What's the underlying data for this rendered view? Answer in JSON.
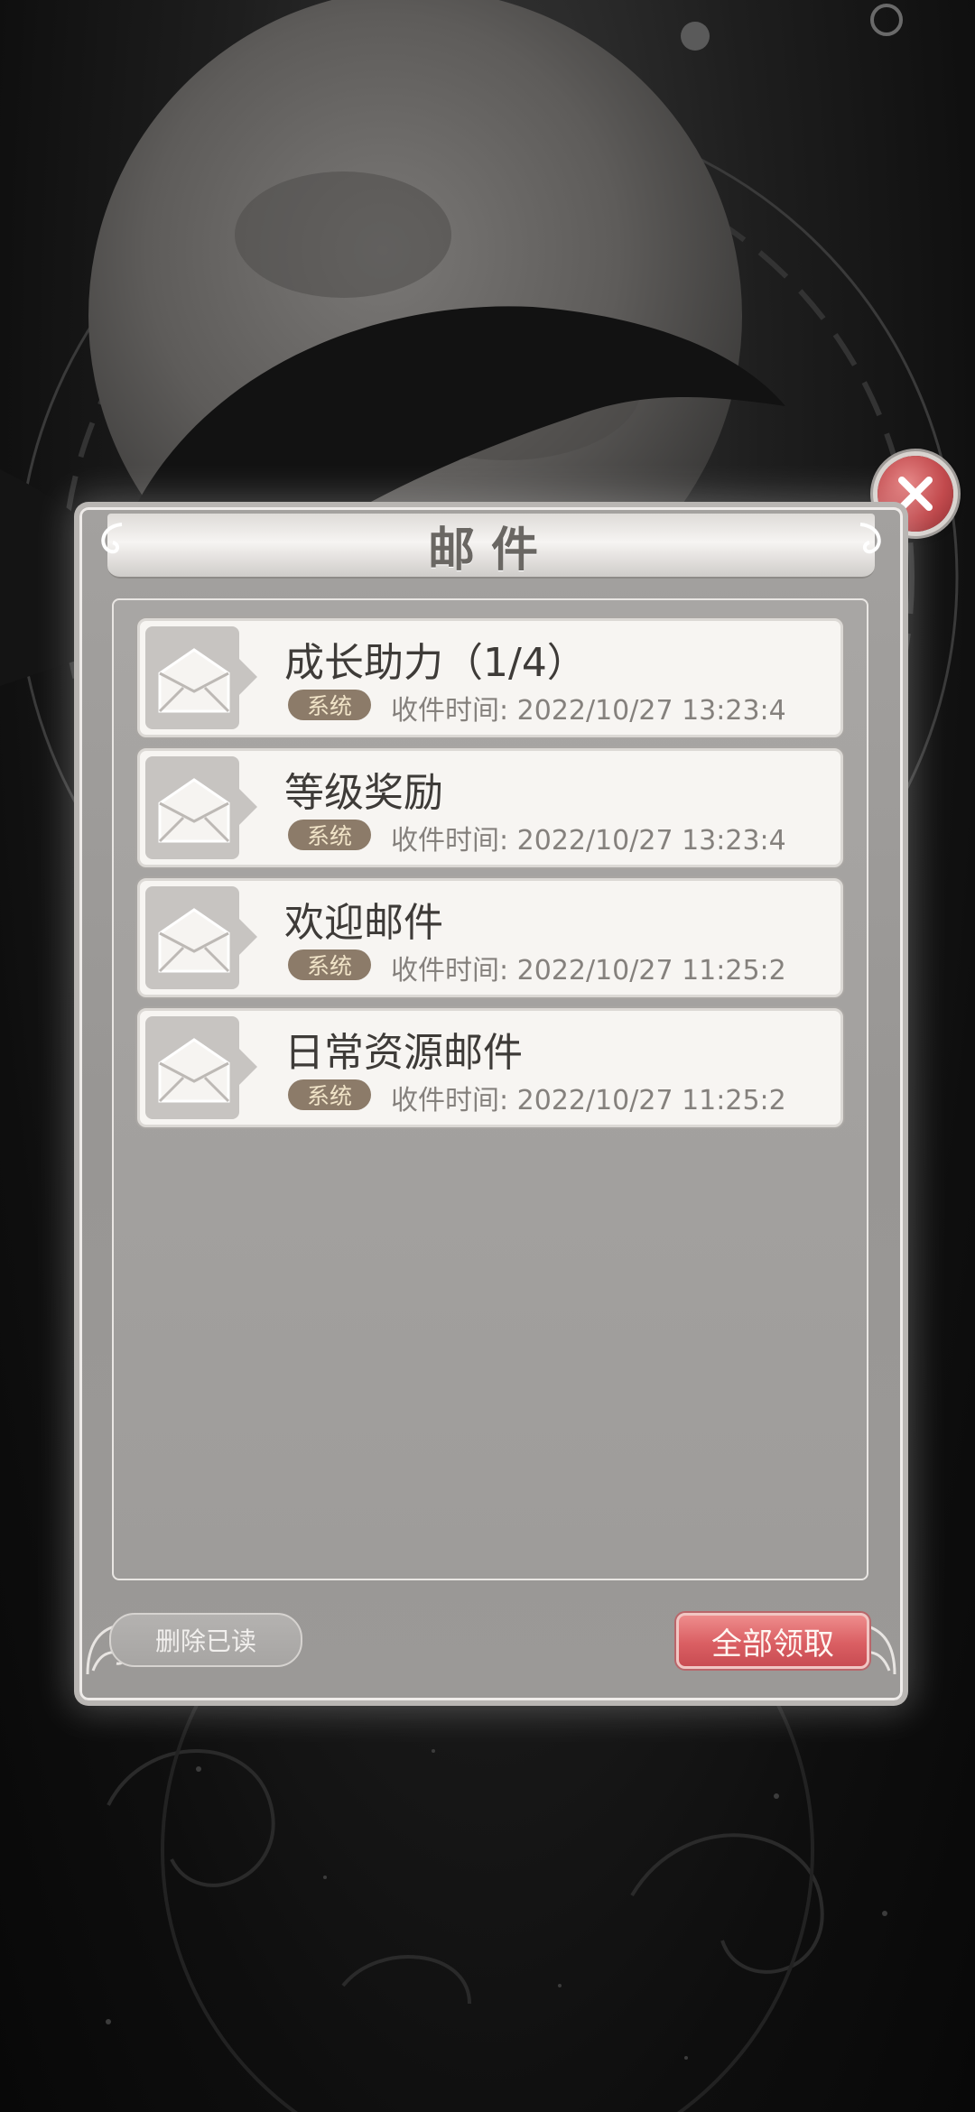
{
  "dialog": {
    "title": "邮件",
    "close_icon": "close-x-icon",
    "accent_color": "#d65a5e"
  },
  "mails": [
    {
      "title": "成长助力（1/4）",
      "tag": "系统",
      "time": "收件时间: 2022/10/27 13:23:4",
      "icon": "envelope-icon"
    },
    {
      "title": "等级奖励",
      "tag": "系统",
      "time": "收件时间: 2022/10/27 13:23:4",
      "icon": "envelope-icon"
    },
    {
      "title": "欢迎邮件",
      "tag": "系统",
      "time": "收件时间: 2022/10/27 11:25:2",
      "icon": "envelope-icon"
    },
    {
      "title": "日常资源邮件",
      "tag": "系统",
      "time": "收件时间: 2022/10/27 11:25:2",
      "icon": "envelope-icon"
    }
  ],
  "footer": {
    "delete_read_label": "删除已读",
    "claim_all_label": "全部领取"
  }
}
